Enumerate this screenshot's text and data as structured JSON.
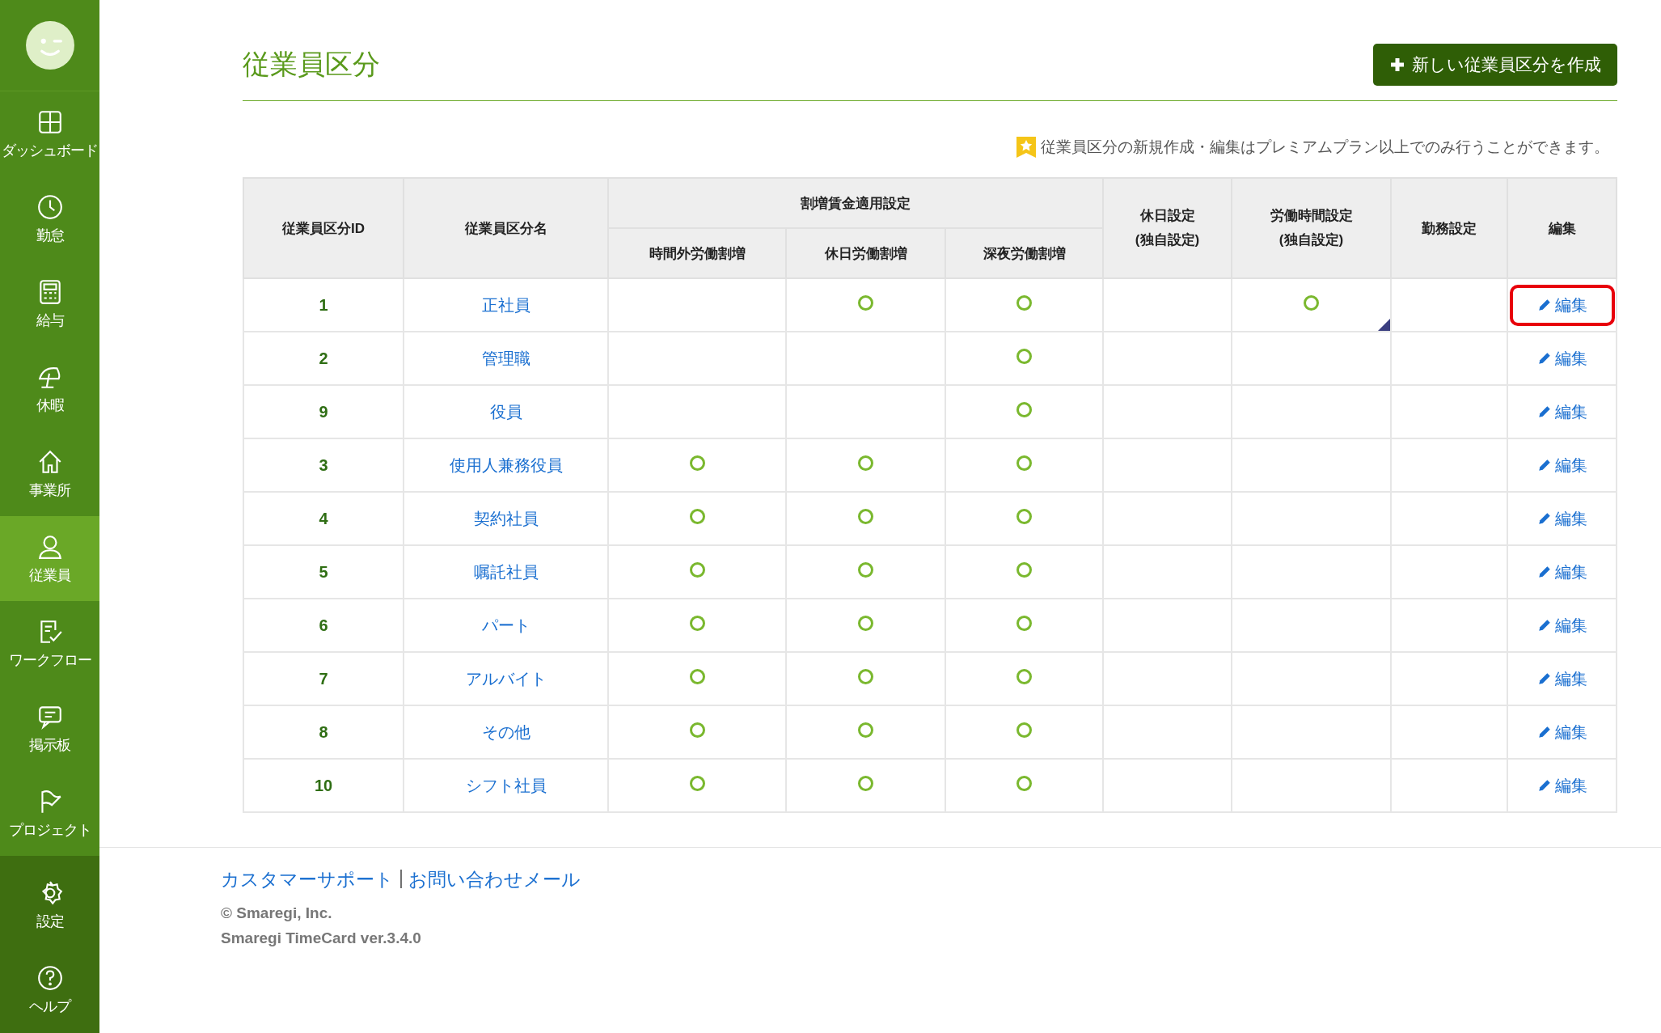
{
  "sidebar": {
    "items": [
      {
        "label": "ダッシュボード",
        "selected": false
      },
      {
        "label": "勤怠",
        "selected": false
      },
      {
        "label": "給与",
        "selected": false
      },
      {
        "label": "休暇",
        "selected": false
      },
      {
        "label": "事業所",
        "selected": false
      },
      {
        "label": "従業員",
        "selected": true
      },
      {
        "label": "ワークフロー",
        "selected": false
      },
      {
        "label": "掲示板",
        "selected": false
      },
      {
        "label": "プロジェクト",
        "selected": false
      }
    ],
    "bottom_items": [
      {
        "label": "設定",
        "selected": false
      },
      {
        "label": "ヘルプ",
        "selected": false
      }
    ]
  },
  "page": {
    "title": "従業員区分",
    "create_button": "新しい従業員区分を作成",
    "notice": "従業員区分の新規作成・編集はプレミアムプラン以上でのみ行うことができます。"
  },
  "table": {
    "columns": {
      "id": "従業員区分ID",
      "name": "従業員区分名",
      "group": "割増賃金適用設定",
      "overtime": "時間外労働割増",
      "holiday_work": "休日労働割増",
      "night": "深夜労働割増",
      "holiday_setting": [
        "休日設定",
        "(独自設定)"
      ],
      "work_hours": [
        "労働時間設定",
        "(独自設定)"
      ],
      "duty": "勤務設定",
      "edit": "編集"
    },
    "rows": [
      {
        "id": "1",
        "name": "正社員",
        "overtime": false,
        "holiday_work": true,
        "night": true,
        "holiday_setting": false,
        "work_hours": true,
        "corner_mark": true,
        "edit": "編集",
        "highlighted": true
      },
      {
        "id": "2",
        "name": "管理職",
        "overtime": false,
        "holiday_work": false,
        "night": true,
        "holiday_setting": false,
        "work_hours": false,
        "corner_mark": false,
        "edit": "編集",
        "highlighted": false
      },
      {
        "id": "9",
        "name": "役員",
        "overtime": false,
        "holiday_work": false,
        "night": true,
        "holiday_setting": false,
        "work_hours": false,
        "corner_mark": false,
        "edit": "編集",
        "highlighted": false
      },
      {
        "id": "3",
        "name": "使用人兼務役員",
        "overtime": true,
        "holiday_work": true,
        "night": true,
        "holiday_setting": false,
        "work_hours": false,
        "corner_mark": false,
        "edit": "編集",
        "highlighted": false
      },
      {
        "id": "4",
        "name": "契約社員",
        "overtime": true,
        "holiday_work": true,
        "night": true,
        "holiday_setting": false,
        "work_hours": false,
        "corner_mark": false,
        "edit": "編集",
        "highlighted": false
      },
      {
        "id": "5",
        "name": "嘱託社員",
        "overtime": true,
        "holiday_work": true,
        "night": true,
        "holiday_setting": false,
        "work_hours": false,
        "corner_mark": false,
        "edit": "編集",
        "highlighted": false
      },
      {
        "id": "6",
        "name": "パート",
        "overtime": true,
        "holiday_work": true,
        "night": true,
        "holiday_setting": false,
        "work_hours": false,
        "corner_mark": false,
        "edit": "編集",
        "highlighted": false
      },
      {
        "id": "7",
        "name": "アルバイト",
        "overtime": true,
        "holiday_work": true,
        "night": true,
        "holiday_setting": false,
        "work_hours": false,
        "corner_mark": false,
        "edit": "編集",
        "highlighted": false
      },
      {
        "id": "8",
        "name": "その他",
        "overtime": true,
        "holiday_work": true,
        "night": true,
        "holiday_setting": false,
        "work_hours": false,
        "corner_mark": false,
        "edit": "編集",
        "highlighted": false
      },
      {
        "id": "10",
        "name": "シフト社員",
        "overtime": true,
        "holiday_work": true,
        "night": true,
        "holiday_setting": false,
        "work_hours": false,
        "corner_mark": false,
        "edit": "編集",
        "highlighted": false
      }
    ]
  },
  "footer": {
    "links": [
      "カスタマーサポート",
      "お問い合わせメール"
    ],
    "separator": "|",
    "copyright": "© Smaregi, Inc.",
    "version": "Smaregi TimeCard ver.3.4.0"
  }
}
